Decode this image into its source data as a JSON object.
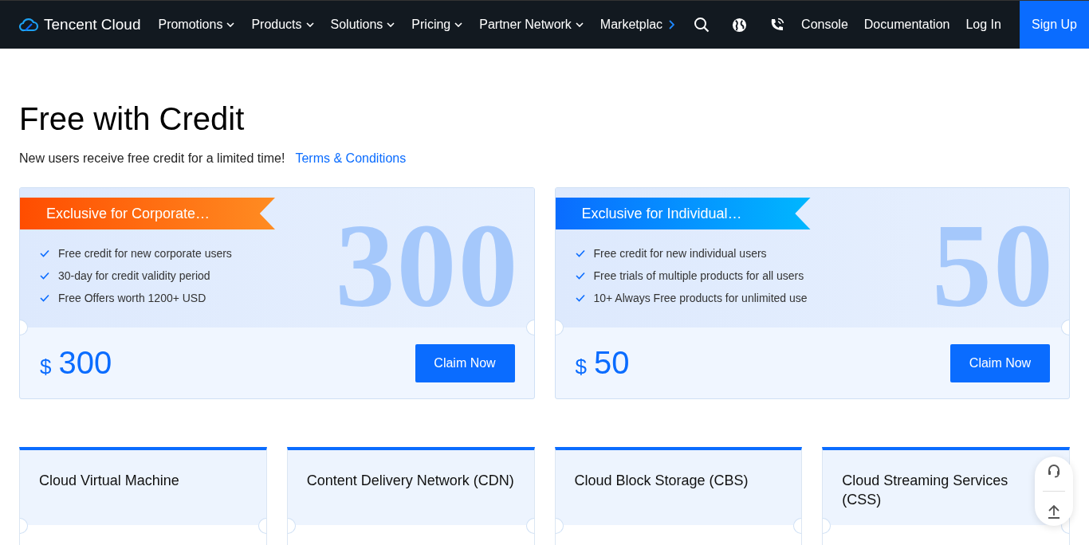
{
  "header": {
    "logo": "Tencent Cloud",
    "nav": [
      {
        "label": "Promotions",
        "kind": "dropdown"
      },
      {
        "label": "Products",
        "kind": "dropdown"
      },
      {
        "label": "Solutions",
        "kind": "dropdown"
      },
      {
        "label": "Pricing",
        "kind": "dropdown"
      },
      {
        "label": "Partner Network",
        "kind": "dropdown"
      },
      {
        "label": "Marketplac",
        "kind": "overflow"
      }
    ],
    "links": [
      "Console",
      "Documentation",
      "Log In"
    ],
    "signup": "Sign Up"
  },
  "title": "Free with Credit",
  "subtitle": "New users receive free credit for a limited time!",
  "terms_link": "Terms & Conditions",
  "offers": [
    {
      "kind": "corporate",
      "ribbon": "Exclusive for Corporate…",
      "features": [
        "Free credit for new corporate users",
        "30-day for credit validity period",
        "Free Offers worth 1200+ USD"
      ],
      "watermark": "300",
      "currency": "$",
      "amount": "300",
      "button": "Claim Now"
    },
    {
      "kind": "individual",
      "ribbon": "Exclusive for Individual…",
      "features": [
        "Free credit for new individual users",
        "Free trials of multiple products for all users",
        "10+ Always Free products for unlimited use"
      ],
      "watermark": "50",
      "currency": "$",
      "amount": "50",
      "button": "Claim Now"
    }
  ],
  "products": [
    "Cloud Virtual Machine",
    "Content Delivery Network (CDN)",
    "Cloud Block Storage (CBS)",
    "Cloud Streaming Services (CSS)"
  ]
}
